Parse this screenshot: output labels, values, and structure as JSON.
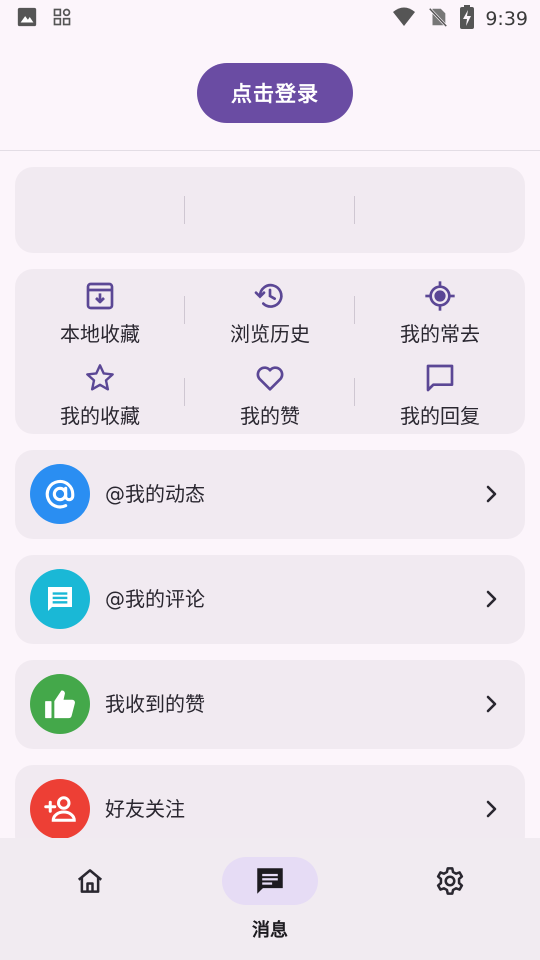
{
  "status_bar": {
    "time": "9:39",
    "left_icons": [
      "image-icon",
      "apps-grid-icon"
    ],
    "right_icons": [
      "wifi-icon",
      "no-sim-icon",
      "battery-charging-icon"
    ]
  },
  "login": {
    "label": "点击登录"
  },
  "shortcuts": [
    {
      "label": "本地收藏",
      "icon": "archive-download-icon"
    },
    {
      "label": "浏览历史",
      "icon": "history-icon"
    },
    {
      "label": "我的常去",
      "icon": "location-target-icon"
    },
    {
      "label": "我的收藏",
      "icon": "star-icon"
    },
    {
      "label": "我的赞",
      "icon": "heart-icon"
    },
    {
      "label": "我的回复",
      "icon": "comment-icon"
    }
  ],
  "list": [
    {
      "label": "@我的动态",
      "icon": "at-icon",
      "color": "#2a8ef2"
    },
    {
      "label": "@我的评论",
      "icon": "chat-icon",
      "color": "#1ab8d6"
    },
    {
      "label": "我收到的赞",
      "icon": "thumbs-up-icon",
      "color": "#44a84a"
    },
    {
      "label": "好友关注",
      "icon": "add-person-icon",
      "color": "#ed3f35"
    }
  ],
  "bottom_nav": {
    "items": [
      {
        "name": "home",
        "label": "",
        "icon": "home-icon"
      },
      {
        "name": "messages",
        "label": "消息",
        "icon": "message-icon",
        "active": true
      },
      {
        "name": "settings",
        "label": "",
        "icon": "gear-icon"
      }
    ]
  },
  "colors": {
    "accent": "#6a4ca3",
    "icon_purple": "#5b4795",
    "background": "#fcf5fb",
    "card": "#f1eaf1"
  }
}
